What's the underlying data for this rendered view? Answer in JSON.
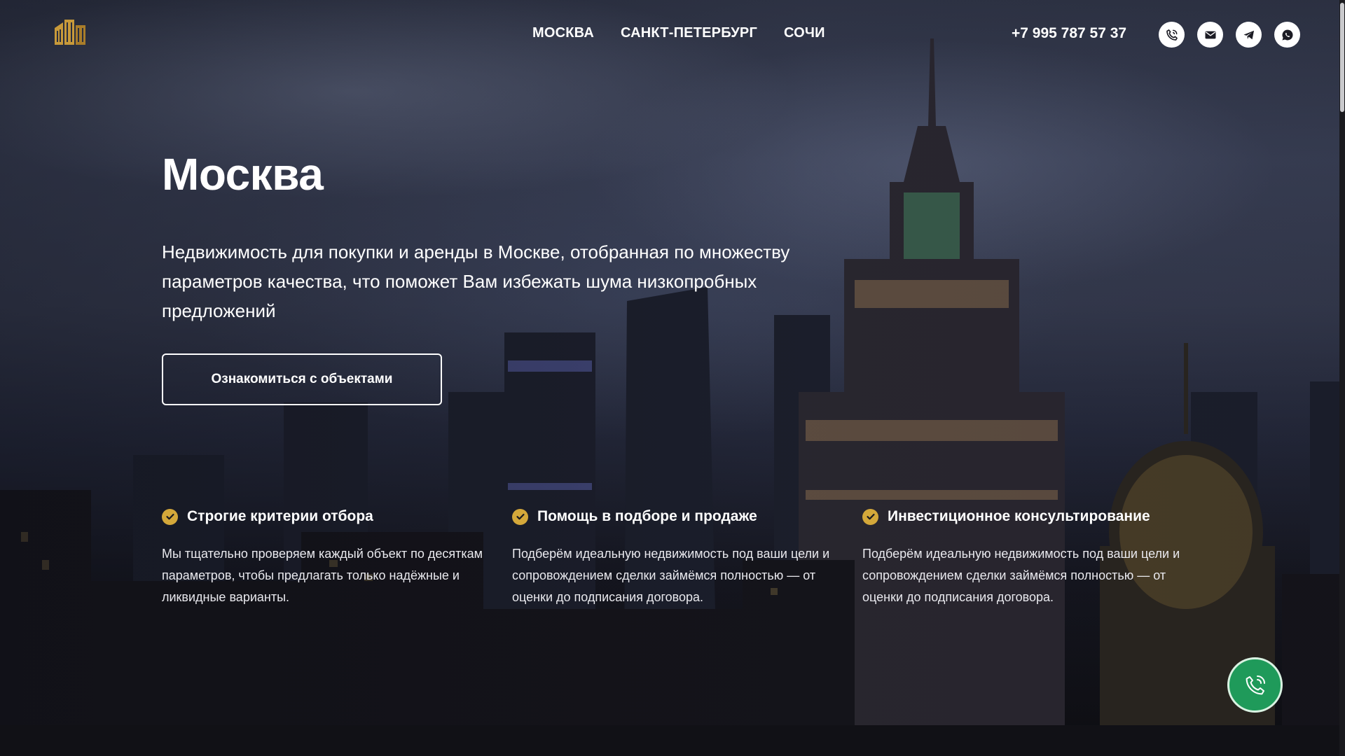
{
  "header": {
    "nav": [
      "МОСКВА",
      "САНКТ-ПЕТЕРБУРГ",
      "СОЧИ"
    ],
    "phone": "+7 995 787 57 37",
    "contact_icons": [
      "phone-icon",
      "mail-icon",
      "telegram-icon",
      "whatsapp-icon"
    ]
  },
  "hero": {
    "title": "Москва",
    "lead": "Недвижимость для покупки и аренды в Москве, отобранная по множеству параметров качества, что поможет Вам избежать шума низкопробных предложений",
    "cta_label": "Ознакомиться с объектами"
  },
  "features": [
    {
      "title": "Строгие критерии отбора",
      "text": "Мы тщательно проверяем каждый объект по десяткам параметров, чтобы предлагать только надёжные и ликвидные варианты."
    },
    {
      "title": "Помощь в подборе и продаже",
      "text": "Подберём идеальную недвижимость под ваши цели и сопровождением сделки займёмся полностью — от оценки до подписания договора."
    },
    {
      "title": "Инвестиционное консультирование",
      "text": "Подберём идеальную недвижимость под ваши цели и сопровождением сделки займёмся полностью — от оценки до подписания договора."
    }
  ],
  "colors": {
    "accent_gold": "#d4a83a",
    "call_green": "#1f9a5a"
  },
  "icons": {
    "logo": "building-logo-icon",
    "check": "check-icon",
    "floating_call": "phone-call-icon"
  }
}
